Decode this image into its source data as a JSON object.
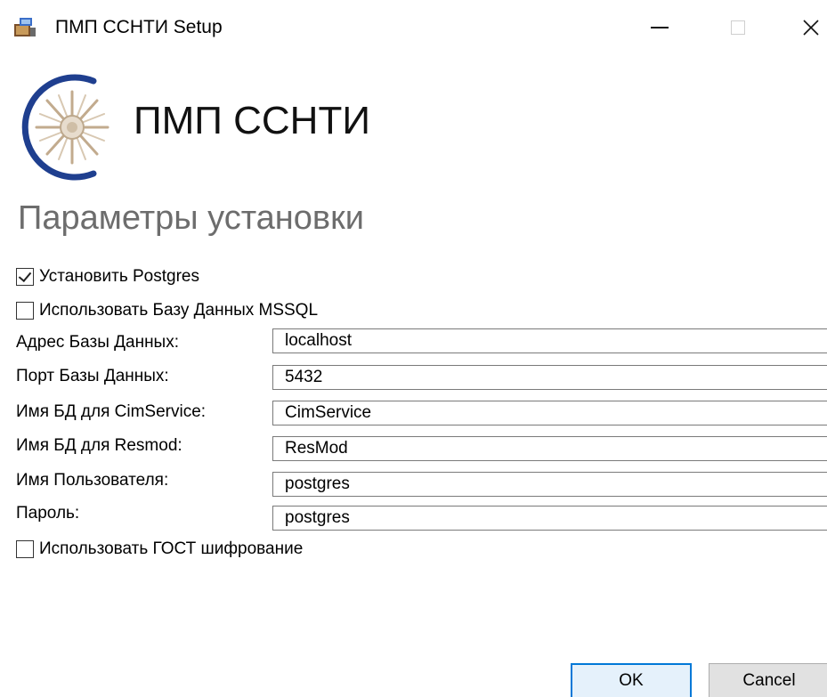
{
  "titlebar": {
    "title": "ПМП ССНТИ Setup",
    "icon": "installer-icon",
    "minimize_icon": "minimize-icon",
    "maximize_icon": "maximize-icon",
    "close_icon": "close-icon",
    "close_glyph": "✕"
  },
  "header": {
    "logo_icon": "gazprom-flame-logo",
    "product_name": "ПМП ССНТИ",
    "section_title": "Параметры установки"
  },
  "options": {
    "install_postgres": {
      "label": "Установить Postgres",
      "checked": true
    },
    "use_mssql": {
      "label": "Использовать Базу Данных MSSQL",
      "checked": false
    },
    "use_gost": {
      "label": "Использовать ГОСТ шифрование",
      "checked": false
    }
  },
  "fields": [
    {
      "label": "Адрес Базы Данных:",
      "value": "localhost"
    },
    {
      "label": "Порт Базы Данных:",
      "value": "5432"
    },
    {
      "label": "Имя БД для CimService:",
      "value": "CimService"
    },
    {
      "label": "Имя БД для Resmod:",
      "value": "ResMod"
    },
    {
      "label": "Имя Пользователя:",
      "value": "postgres"
    },
    {
      "label": "Пароль:",
      "value": "postgres"
    }
  ],
  "buttons": {
    "ok": "OK",
    "cancel": "Cancel"
  },
  "colors": {
    "accent": "#0078d7",
    "logo_blue": "#1f3f8f",
    "section_title": "#6d6d6d"
  }
}
